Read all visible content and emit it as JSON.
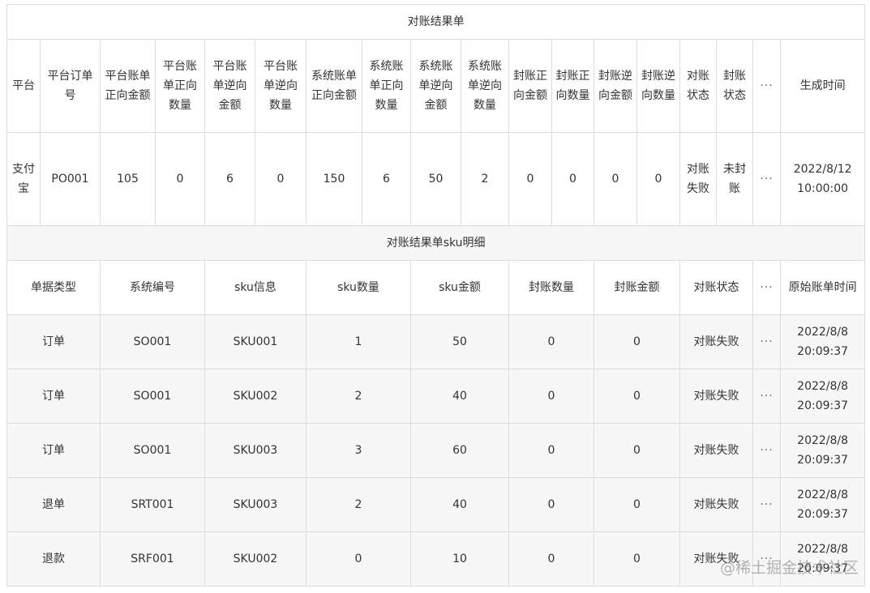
{
  "title": "对账结果单",
  "summary_headers": [
    "平台",
    "平台订单号",
    "平台账单正向金额",
    "平台账单正向数量",
    "平台账单逆向金额",
    "平台账单逆向数量",
    "系统账单正向金额",
    "系统账单正向数量",
    "系统账单逆向金额",
    "系统账单逆向数量",
    "封账正向金额",
    "封账正向数量",
    "封账逆向金额",
    "封账逆向数量",
    "对账状态",
    "封账状态",
    "···",
    "生成时间"
  ],
  "summary_row": [
    "支付宝",
    "PO001",
    "105",
    "0",
    "6",
    "0",
    "150",
    "6",
    "50",
    "2",
    "0",
    "0",
    "0",
    "0",
    "对账失败",
    "未封账",
    "···",
    "2022/8/12 10:00:00"
  ],
  "detail_title": "对账结果单sku明细",
  "detail_headers": [
    "单据类型",
    "系统编号",
    "sku信息",
    "sku数量",
    "sku金额",
    "封账数量",
    "封账金额",
    "对账状态",
    "···",
    "原始账单时间"
  ],
  "detail_rows": [
    [
      "订单",
      "SO001",
      "SKU001",
      "1",
      "50",
      "0",
      "0",
      "对账失败",
      "···",
      "2022/8/8 20:09:37"
    ],
    [
      "订单",
      "SO001",
      "SKU002",
      "2",
      "40",
      "0",
      "0",
      "对账失败",
      "···",
      "2022/8/8 20:09:37"
    ],
    [
      "订单",
      "SO001",
      "SKU003",
      "3",
      "60",
      "0",
      "0",
      "对账失败",
      "···",
      "2022/8/8 20:09:37"
    ],
    [
      "退单",
      "SRT001",
      "SKU003",
      "2",
      "40",
      "0",
      "0",
      "对账失败",
      "···",
      "2022/8/8 20:09:37"
    ],
    [
      "退款",
      "SRF001",
      "SKU002",
      "0",
      "10",
      "0",
      "0",
      "对账失败",
      "···",
      "2022/8/8 20:09:37"
    ]
  ],
  "watermark": "@稀土掘金技术社区"
}
